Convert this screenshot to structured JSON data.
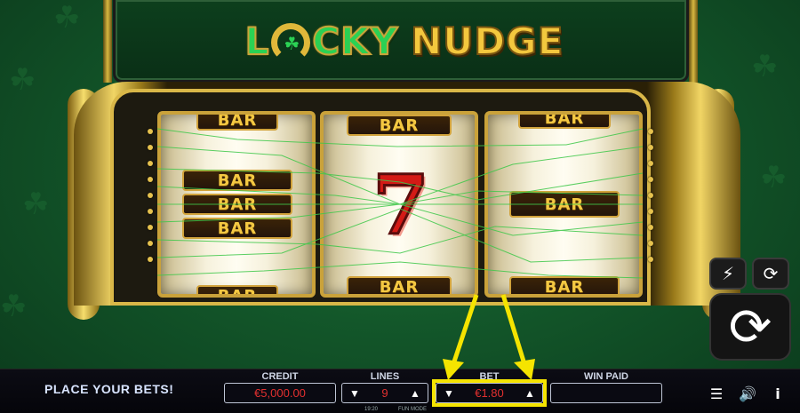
{
  "game": {
    "logo_part1": "LUCKY",
    "logo_part2": "NUDGE"
  },
  "reels": {
    "symbol_bar": "BAR",
    "reel1": [
      "BAR",
      "BAR",
      "BAR",
      "BAR",
      "BAR"
    ],
    "reel2": [
      "BAR",
      "7",
      "BAR"
    ],
    "reel3": [
      "BAR",
      "BAR",
      "BAR"
    ],
    "seven": "7"
  },
  "status": {
    "message": "PLACE YOUR BETS!"
  },
  "meters": {
    "credit_label": "CREDIT",
    "credit_value": "€5,000.00",
    "lines_label": "LINES",
    "lines_value": "9",
    "bet_label": "BET",
    "bet_value": "€1.80",
    "win_label": "WIN PAID",
    "win_value": ""
  },
  "footer": {
    "time": "19:20",
    "mode": "FUN MODE"
  },
  "icons": {
    "turbo": "lightning-off-icon",
    "autoplay": "autoplay-icon",
    "spin": "spin-icon",
    "menu": "menu-icon",
    "sound": "sound-icon",
    "info": "info-icon"
  },
  "colors": {
    "highlight": "#f5e400",
    "meter_text": "#e2302f",
    "bar_gold": "#f4c842",
    "felt": "#13572a"
  }
}
